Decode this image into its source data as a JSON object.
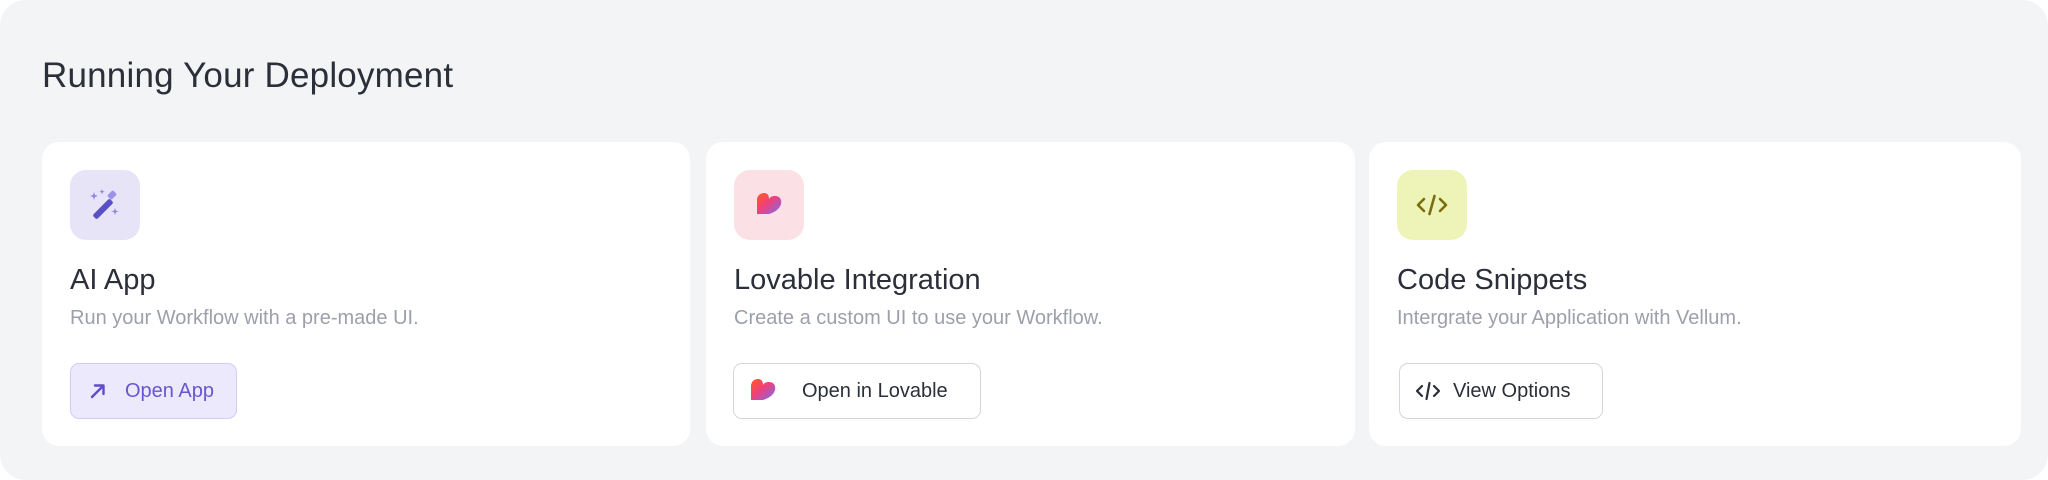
{
  "section": {
    "title": "Running Your Deployment"
  },
  "cards": [
    {
      "title": "AI App",
      "description": "Run your Workflow with a pre-made UI.",
      "icon": "magic-wand-icon",
      "icon_bg": "#e6e4f6",
      "button": {
        "label": "Open App",
        "icon": "arrow-up-right-icon",
        "accent": "#6a55cf"
      }
    },
    {
      "title": "Lovable Integration",
      "description": "Create a custom UI to use your Workflow.",
      "icon": "lovable-heart-icon",
      "icon_bg": "#fbe0e6",
      "button": {
        "label": "Open in Lovable",
        "icon": "lovable-heart-icon"
      }
    },
    {
      "title": "Code Snippets",
      "description": "Intergrate your Application with Vellum.",
      "icon": "code-icon",
      "icon_bg": "#eef4b8",
      "button": {
        "label": "View Options",
        "icon": "code-icon"
      }
    }
  ]
}
